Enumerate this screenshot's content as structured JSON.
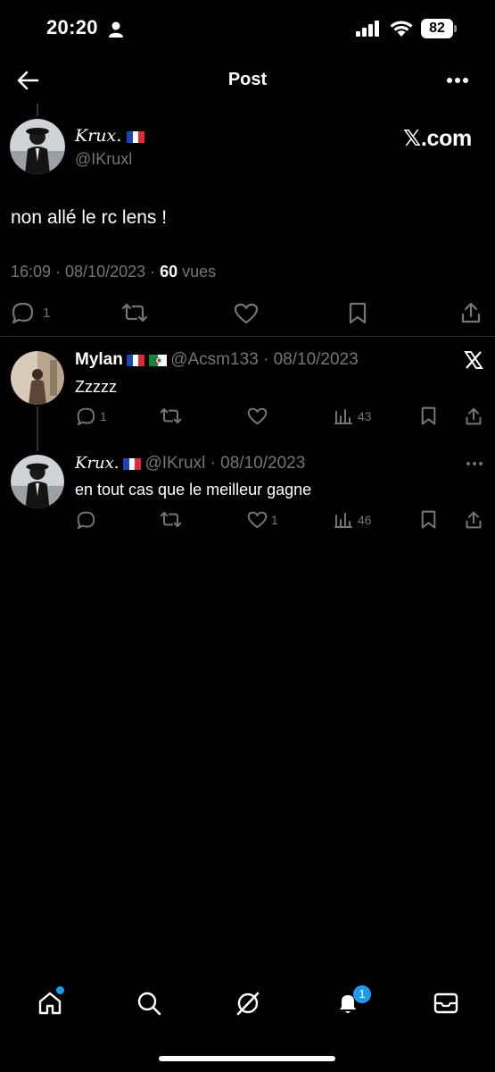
{
  "status_bar": {
    "time": "20:20",
    "battery": "82"
  },
  "header": {
    "title": "Post"
  },
  "main_post": {
    "author_name": "𝐾𝑟𝑢𝑥.",
    "handle": "@IKruxl",
    "brand": "𝕏.com",
    "text": "non allé le rc lens !",
    "time_date": "16:09 · 08/10/2023 · ",
    "views": "60",
    "views_label": " vues",
    "reply_count": "1"
  },
  "replies": [
    {
      "name": "Mylan",
      "meta": "@Acsm133 · 08/10/2023",
      "text": "Zzzzz",
      "reply_count": "1",
      "views": "43"
    },
    {
      "name": "𝐾𝑟𝑢𝑥.",
      "meta": "@IKruxl · 08/10/2023",
      "text": "en tout cas que le meilleur gagne",
      "like_count": "1",
      "views": "46"
    }
  ],
  "tabbar": {
    "notifications_badge": "1"
  },
  "colors": {
    "accent": "#1d9bf0",
    "muted": "#71767b",
    "background": "#000000"
  }
}
